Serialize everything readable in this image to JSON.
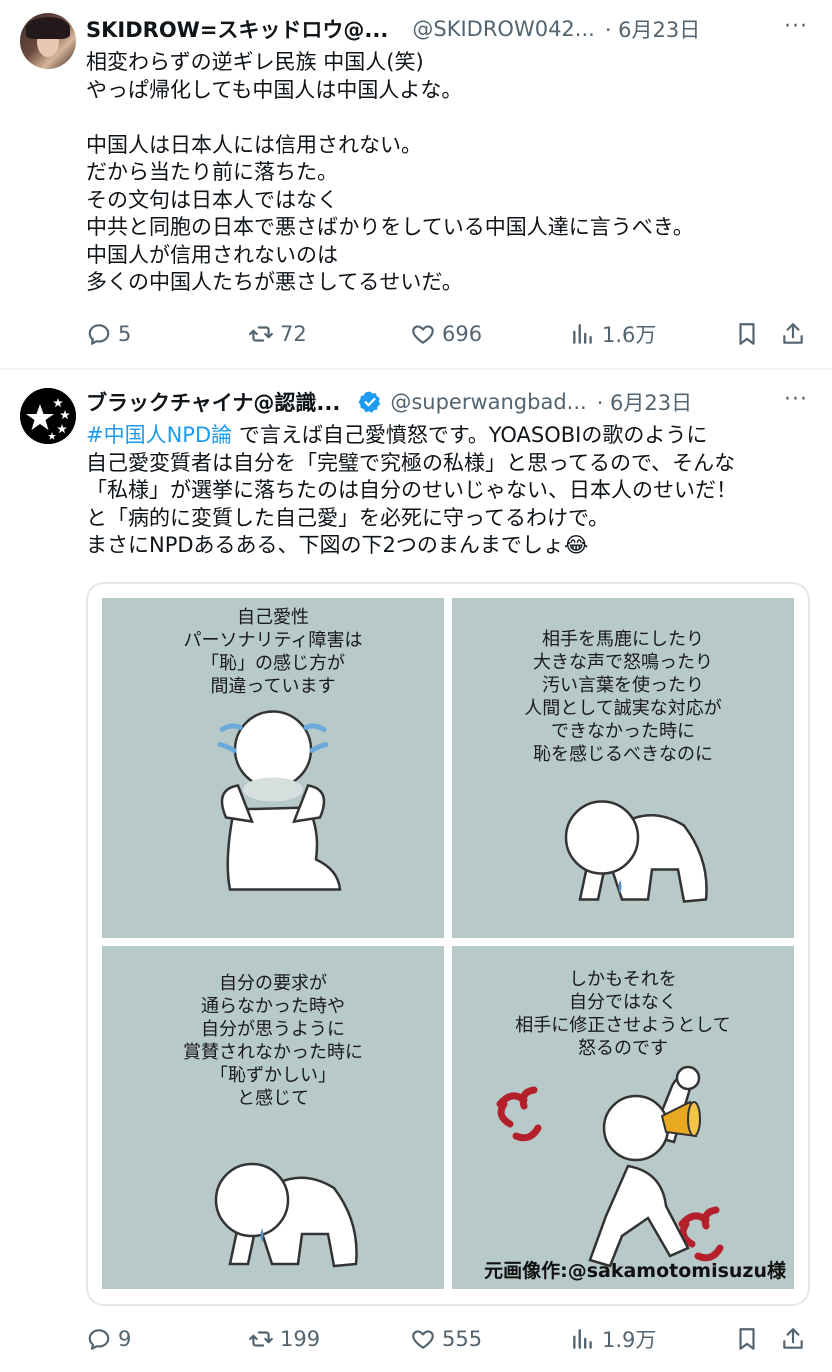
{
  "tweets": [
    {
      "author_name": "SKIDROW=スキッドロウ@...",
      "handle": "@SKIDROW042...",
      "date": "· 6月23日",
      "more": "···",
      "text": "相変わらずの逆ギレ民族 中国人(笑)\nやっぱ帰化しても中国人は中国人よな。\n\n中国人は日本人には信用されない。\nだから当たり前に落ちた。\nその文句は日本人ではなく\n中共と同胞の日本で悪さばかりをしている中国人達に言うべき。\n中国人が信用されないのは\n多くの中国人たちが悪さしてるせいだ。",
      "replies": "5",
      "reposts": "72",
      "likes": "696",
      "views": "1.6万"
    },
    {
      "author_name": "ブラックチャイナ@認識...",
      "handle": "@superwangbad...",
      "date": "· 6月23日",
      "more": "···",
      "hashtag": "#中国人NPD論",
      "text": " で言えば自己愛憤怒です。YOASOBIの歌のように\n自己愛変質者は自分を「完璧で究極の私様」と思ってるので、そんな\n「私様」が選挙に落ちたのは自分のせいじゃない、日本人のせいだ！\nと「病的に変質した自己愛」を必死に守ってるわけで。\nまさにNPDあるある、下図の下2つのまんまでしょ😂",
      "replies": "9",
      "reposts": "199",
      "likes": "555",
      "views": "1.9万",
      "image": {
        "panels": [
          {
            "text": "自己愛性\nパーソナリティ障害は\n「恥」の感じ方が\n間違っています"
          },
          {
            "text": "相手を馬鹿にしたり\n大きな声で怒鳴ったり\n汚い言葉を使ったり\n人間として誠実な対応が\nできなかった時に\n恥を感じるべきなのに"
          },
          {
            "text": "自分の要求が\n通らなかった時や\n自分が思うように\n賞賛されなかった時に\n「恥ずかしい」\nと感じて"
          },
          {
            "text": "しかもそれを\n自分ではなく\n相手に修正させようとして\n怒るのです"
          }
        ],
        "credit": "元画像作:@sakamotomisuzu様"
      }
    }
  ],
  "colors": {
    "accent": "#1d9bf0",
    "muted": "#536471",
    "panel_bg": "#b8c9c9",
    "anger": "#b3202a"
  }
}
